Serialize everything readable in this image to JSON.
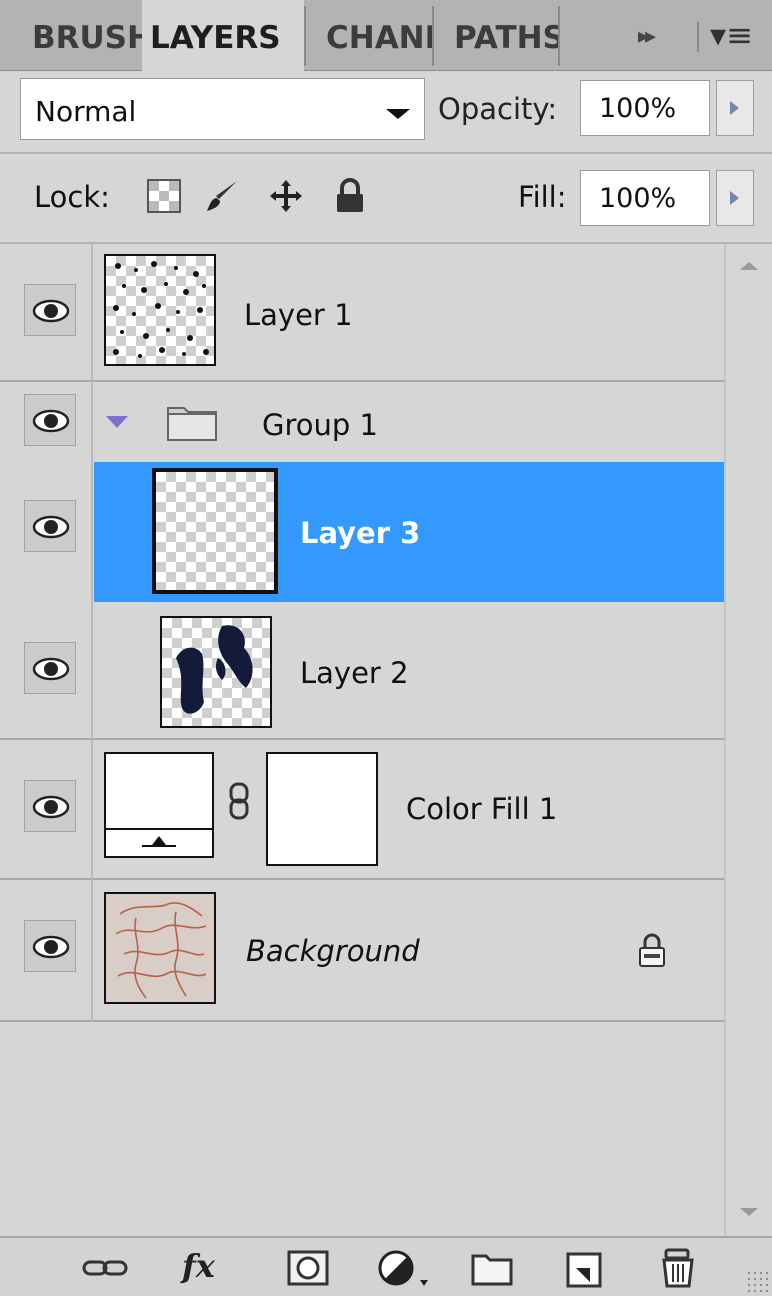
{
  "tabs": {
    "brushes": "BRUSHES",
    "layers": "LAYERS",
    "channels": "CHANNELS",
    "paths": "PATHS",
    "more_glyph": "▸▸",
    "menu_glyph": "▾≡"
  },
  "blend": {
    "mode": "Normal",
    "opacity_label": "Opacity:",
    "opacity_value": "100%"
  },
  "lock": {
    "label": "Lock:",
    "fill_label": "Fill:",
    "fill_value": "100%",
    "icons": [
      "lock-transparent-pixels-icon",
      "lock-image-pixels-icon",
      "lock-position-icon",
      "lock-all-icon"
    ]
  },
  "layers": [
    {
      "name": "Layer 1",
      "visible": true,
      "thumb": "checker-texture"
    },
    {
      "name": "Group 1",
      "visible": true,
      "type": "group",
      "expanded": true
    },
    {
      "name": "Layer 3",
      "visible": true,
      "selected": true,
      "thumb": "empty-checker"
    },
    {
      "name": "Layer 2",
      "visible": true,
      "thumb": "checker-silhouette"
    },
    {
      "name": "Color Fill 1",
      "visible": true,
      "type": "fill",
      "linked_mask": true
    },
    {
      "name": "Background",
      "visible": true,
      "locked": true,
      "thumb": "sketch"
    }
  ],
  "colors": {
    "selection": "#3399ff",
    "panel": "#d6d6d6",
    "tab_bar": "#b3b3b3"
  },
  "bottom_bar": [
    "link-layers-icon",
    "fx-icon",
    "add-mask-icon",
    "adjustment-layer-icon",
    "new-group-icon",
    "new-layer-icon",
    "delete-layer-icon"
  ],
  "bottom_labels": {
    "fx": "fx"
  }
}
